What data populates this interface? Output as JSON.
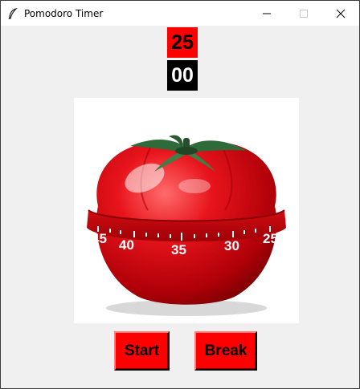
{
  "window": {
    "title": "Pomodoro Timer"
  },
  "titlebar_icons": {
    "app": "feather-icon",
    "minimize": "minimize-icon",
    "maximize": "maximize-icon",
    "close": "close-icon"
  },
  "timer": {
    "minutes": "25",
    "seconds": "00"
  },
  "image": {
    "icon": "tomato-timer-image",
    "dial_numbers": [
      "45",
      "40",
      "35",
      "30",
      "25"
    ]
  },
  "buttons": {
    "start_label": "Start",
    "break_label": "Break"
  },
  "colors": {
    "accent": "#ff0000",
    "seconds_bg": "#000000",
    "background": "#f0f0f0"
  }
}
